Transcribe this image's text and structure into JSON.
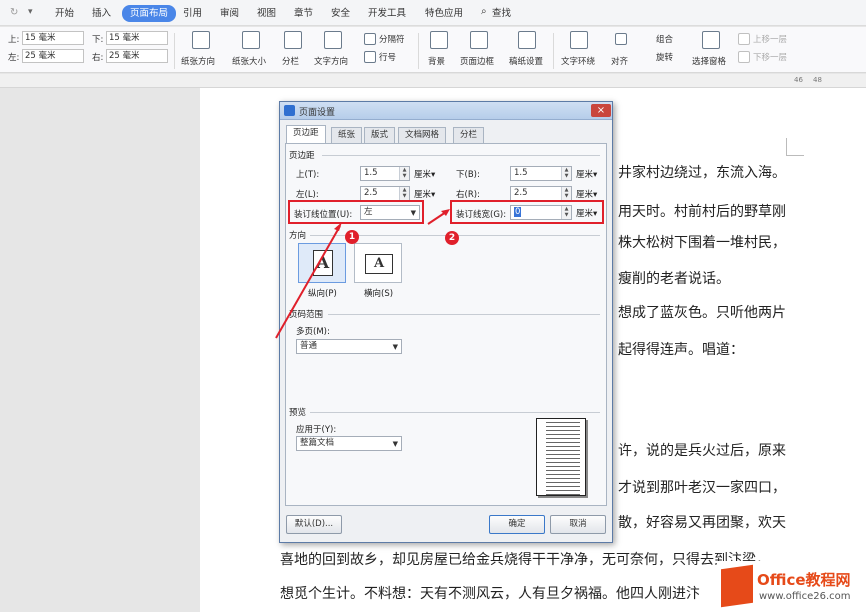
{
  "menubar": {
    "items": [
      "开始",
      "插入",
      "页面布局",
      "引用",
      "审阅",
      "视图",
      "章节",
      "安全",
      "开发工具",
      "特色应用"
    ],
    "search": "查找"
  },
  "ribbon": {
    "margin_top_label": "上:",
    "margin_top": "15 毫米",
    "margin_bottom_label": "下:",
    "margin_bottom": "15 毫米",
    "margin_left_label": "左:",
    "margin_left": "25 毫米",
    "margin_right_label": "右:",
    "margin_right": "25 毫米",
    "buttons": [
      "纸张方向",
      "纸张大小",
      "分栏",
      "文字方向",
      "分隔符",
      "行号",
      "背景",
      "页面边框",
      "稿纸设置",
      "文字环绕",
      "对齐",
      "旋转",
      "组合",
      "选择窗格",
      "上移一层",
      "下移一层"
    ]
  },
  "ruler": {
    "ticks": [
      "46",
      "48"
    ]
  },
  "document": {
    "lines": [
      "井家村边绕过，东流入海。",
      "用天时。村前村后的野草刚",
      "株大松树下围着一堆村民，",
      "瘦削的老者说话。",
      "想成了蓝灰色。只听他两片",
      "起得得连声。唱道：",
      "许，说的是兵火过后，原来",
      "才说到那叶老汉一家四口，",
      "散，好容易又再团聚，欢天",
      "喜地的回到故乡，却见房屋已给金兵烧得干干净净，无可奈何，只得去到汴梁，",
      "想觅个生计。不料想：天有不测风云，人有旦夕祸福。他四人刚进汴"
    ]
  },
  "dialog": {
    "title": "页面设置",
    "close": "×",
    "tabs": [
      "页边距",
      "纸张",
      "版式",
      "文档网格",
      "分栏"
    ],
    "margins_group": "页边距",
    "top_label": "上(T):",
    "top_value": "1.5",
    "bottom_label": "下(B):",
    "bottom_value": "1.5",
    "left_label": "左(L):",
    "left_value": "2.5",
    "right_label": "右(R):",
    "right_value": "2.5",
    "unit": "厘米",
    "gutter_pos_label": "装订线位置(U):",
    "gutter_pos_value": "左",
    "gutter_label": "装订线宽(G):",
    "gutter_value": "0",
    "orientation_group": "方向",
    "portrait": "纵向(P)",
    "landscape": "横向(S)",
    "pages_group": "页码范围",
    "multi_label": "多页(M):",
    "multi_value": "普通",
    "preview_group": "预览",
    "apply_label": "应用于(Y):",
    "apply_value": "整篇文档",
    "default_btn": "默认(D)...",
    "ok_btn": "确定",
    "cancel_btn": "取消"
  },
  "annotations": {
    "badge1": "1",
    "badge2": "2",
    "color": "#e0202b"
  },
  "watermark": {
    "brand": "Office教程网",
    "url": "www.office26.com"
  }
}
